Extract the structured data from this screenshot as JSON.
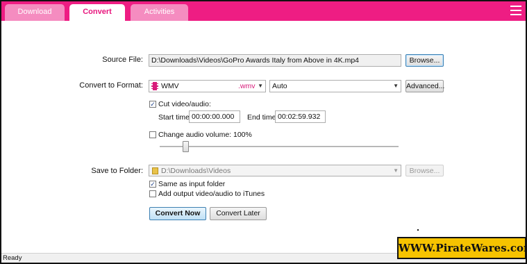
{
  "tabs": [
    {
      "label": "Download",
      "active": false
    },
    {
      "label": "Convert",
      "active": true
    },
    {
      "label": "Activities",
      "active": false
    }
  ],
  "menu": {
    "icon": "hamburger-menu-icon"
  },
  "source": {
    "label": "Source File:",
    "value": "D:\\Downloads\\Videos\\GoPro Awards  Italy from Above in 4K.mp4",
    "browse_label": "Browse..."
  },
  "format": {
    "label": "Convert to Format:",
    "name": "WMV",
    "ext": ".wmv",
    "quality": "Auto",
    "advanced_label": "Advanced..."
  },
  "cut": {
    "label": "Cut video/audio:",
    "checked": true,
    "start_label": "Start time:",
    "start_value": "00:00:00.000",
    "end_label": "End time:",
    "end_value": "00:02:59.932"
  },
  "volume": {
    "label": "Change audio volume: 100%",
    "checked": false,
    "level_percent": 100
  },
  "save": {
    "label": "Save to Folder:",
    "value": "D:\\Downloads\\Videos",
    "browse_label": "Browse...",
    "same_as_input_label": "Same as input folder",
    "same_as_input_checked": true,
    "itunes_label": "Add output video/audio to iTunes",
    "itunes_checked": false
  },
  "actions": {
    "convert_now": "Convert Now",
    "convert_later": "Convert Later"
  },
  "status": {
    "text": "Ready"
  },
  "watermark": {
    "text": "WWW.PirateWares.com"
  },
  "colors": {
    "accent": "#ee1d83",
    "watermark_bg": "#f6c300"
  }
}
